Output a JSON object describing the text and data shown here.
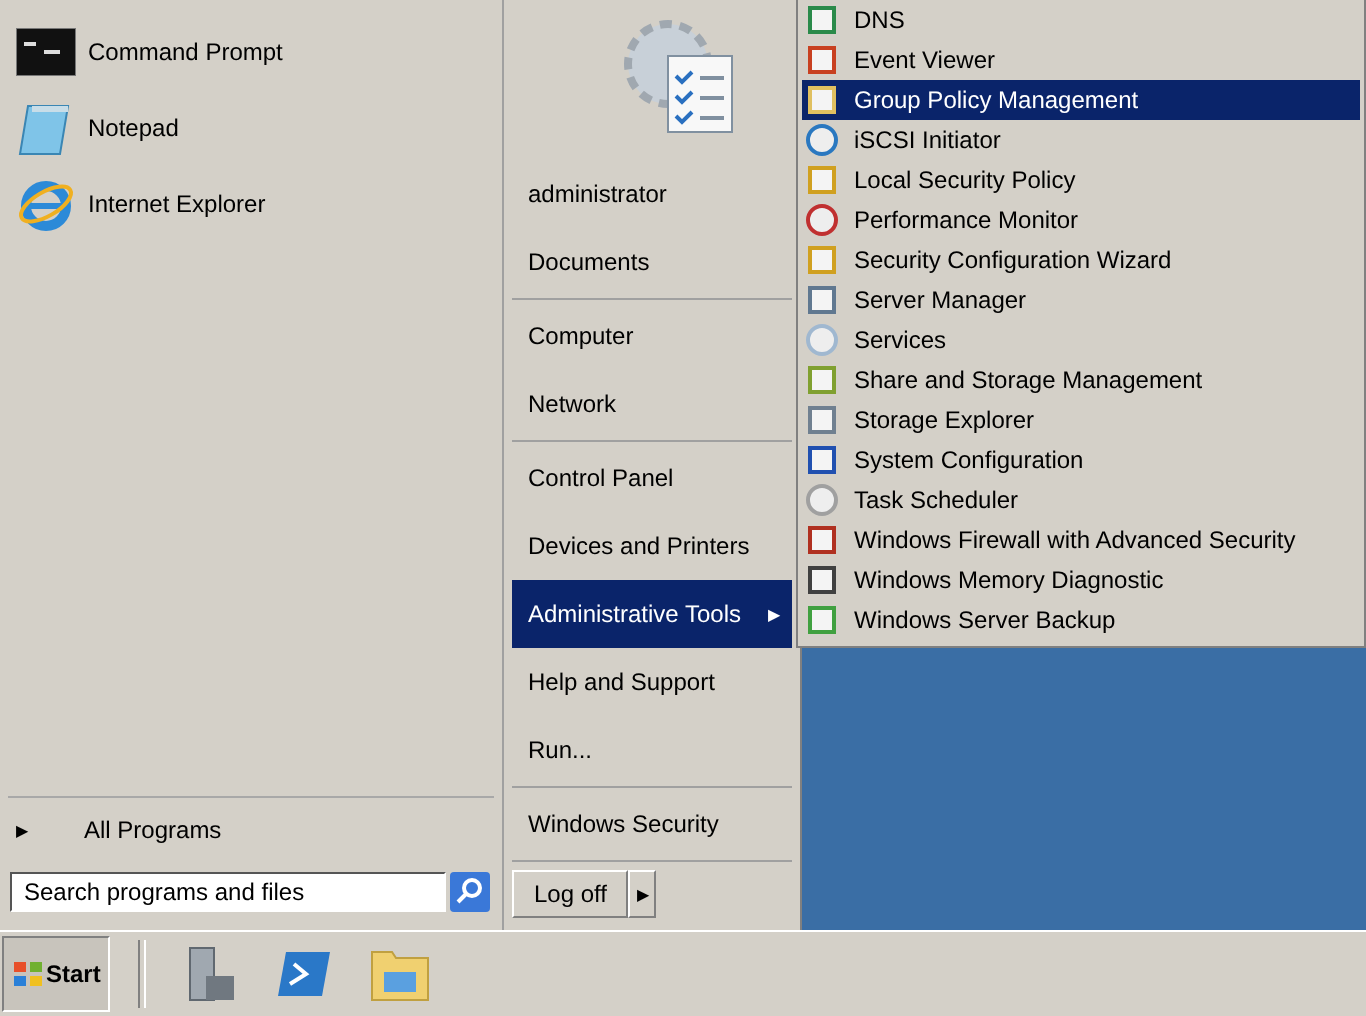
{
  "start_menu": {
    "pinned": [
      {
        "label": "Command Prompt"
      },
      {
        "label": "Notepad"
      },
      {
        "label": "Internet Explorer"
      }
    ],
    "all_programs": {
      "arrow": "▶",
      "label": "All Programs"
    },
    "search": {
      "placeholder": "Search programs and files"
    },
    "right_groups": [
      [
        {
          "label": "administrator",
          "selected": false,
          "submenu": false
        },
        {
          "label": "Documents",
          "selected": false,
          "submenu": false
        }
      ],
      [
        {
          "label": "Computer",
          "selected": false,
          "submenu": false
        },
        {
          "label": "Network",
          "selected": false,
          "submenu": false
        }
      ],
      [
        {
          "label": "Control Panel",
          "selected": false,
          "submenu": false
        },
        {
          "label": "Devices and Printers",
          "selected": false,
          "submenu": false
        },
        {
          "label": "Administrative Tools",
          "selected": true,
          "submenu": true
        },
        {
          "label": "Help and Support",
          "selected": false,
          "submenu": false
        },
        {
          "label": "Run...",
          "selected": false,
          "submenu": false
        }
      ],
      [
        {
          "label": "Windows Security",
          "selected": false,
          "submenu": false
        }
      ]
    ],
    "log_off": {
      "label": "Log off",
      "arrow": "▶"
    }
  },
  "submenu": {
    "items": [
      {
        "label": "DNS",
        "selected": false
      },
      {
        "label": "Event Viewer",
        "selected": false
      },
      {
        "label": "Group Policy Management",
        "selected": true
      },
      {
        "label": "iSCSI Initiator",
        "selected": false
      },
      {
        "label": "Local Security Policy",
        "selected": false
      },
      {
        "label": "Performance Monitor",
        "selected": false
      },
      {
        "label": "Security Configuration Wizard",
        "selected": false
      },
      {
        "label": "Server Manager",
        "selected": false
      },
      {
        "label": "Services",
        "selected": false
      },
      {
        "label": "Share and Storage Management",
        "selected": false
      },
      {
        "label": "Storage Explorer",
        "selected": false
      },
      {
        "label": "System Configuration",
        "selected": false
      },
      {
        "label": "Task Scheduler",
        "selected": false
      },
      {
        "label": "Windows Firewall with Advanced Security",
        "selected": false
      },
      {
        "label": "Windows Memory Diagnostic",
        "selected": false
      },
      {
        "label": "Windows Server Backup",
        "selected": false
      }
    ]
  },
  "taskbar": {
    "start": {
      "label": "Start"
    }
  }
}
